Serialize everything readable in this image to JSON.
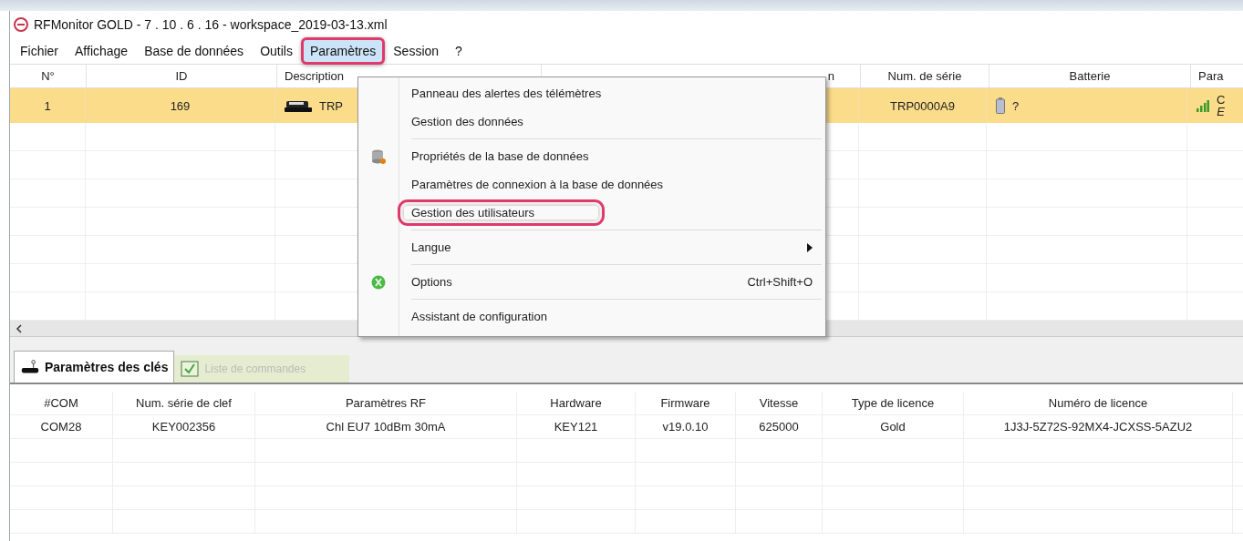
{
  "window": {
    "title": "RFMonitor GOLD - 7 . 10 . 6 . 16 - workspace_2019-03-13.xml"
  },
  "menubar": [
    {
      "label": "Fichier",
      "selected": false,
      "annotated": false
    },
    {
      "label": "Affichage",
      "selected": false,
      "annotated": false
    },
    {
      "label": "Base de données",
      "selected": false,
      "annotated": false
    },
    {
      "label": "Outils",
      "selected": false,
      "annotated": false
    },
    {
      "label": "Paramètres",
      "selected": true,
      "annotated": true
    },
    {
      "label": "Session",
      "selected": false,
      "annotated": false
    },
    {
      "label": "?",
      "selected": false,
      "annotated": false
    }
  ],
  "menu": {
    "groups": [
      [
        {
          "label": "Panneau des alertes des télémètres",
          "kind": "plain",
          "annotated": false
        },
        {
          "label": "Gestion des données",
          "kind": "plain",
          "annotated": false
        }
      ],
      [
        {
          "label": "Propriétés de la base de données",
          "kind": "database",
          "annotated": false
        },
        {
          "label": "Paramètres de connexion à la base de données",
          "kind": "plain",
          "annotated": false
        },
        {
          "label": "Gestion des utilisateurs",
          "kind": "plain",
          "annotated": true
        }
      ],
      [
        {
          "label": "Langue",
          "kind": "submenu",
          "annotated": false
        }
      ],
      [
        {
          "label": "Options",
          "kind": "options",
          "annotated": false,
          "shortcut": "Ctrl+Shift+O"
        }
      ],
      [
        {
          "label": "Assistant de configuration",
          "kind": "plain",
          "annotated": false
        }
      ]
    ]
  },
  "devices_table": {
    "columns": [
      "N°",
      "ID",
      "Description",
      "n",
      "Num. de série",
      "Batterie",
      "Para"
    ],
    "rows": [
      {
        "selected": true,
        "number": "1",
        "id": "169",
        "description": "TRP",
        "serial": "TRP0000A9",
        "battery": "?",
        "param_lines": [
          "C",
          "E"
        ]
      }
    ]
  },
  "bottom_tabs": [
    {
      "label": "Paramètres des clés",
      "selected": true
    },
    {
      "label": "Liste de commandes",
      "selected": false
    }
  ],
  "keys_table": {
    "columns": [
      "#COM",
      "Num. série de clef",
      "Paramètres RF",
      "Hardware",
      "Firmware",
      "Vitesse",
      "Type de licence",
      "Numéro de licence"
    ],
    "rows": [
      [
        "COM28",
        "KEY002356",
        "Chl EU7  10dBm 30mA",
        "KEY121",
        "v19.0.10",
        "625000",
        "Gold",
        "1J3J-5Z72S-92MX4-JCXSS-5AZU2"
      ]
    ]
  }
}
